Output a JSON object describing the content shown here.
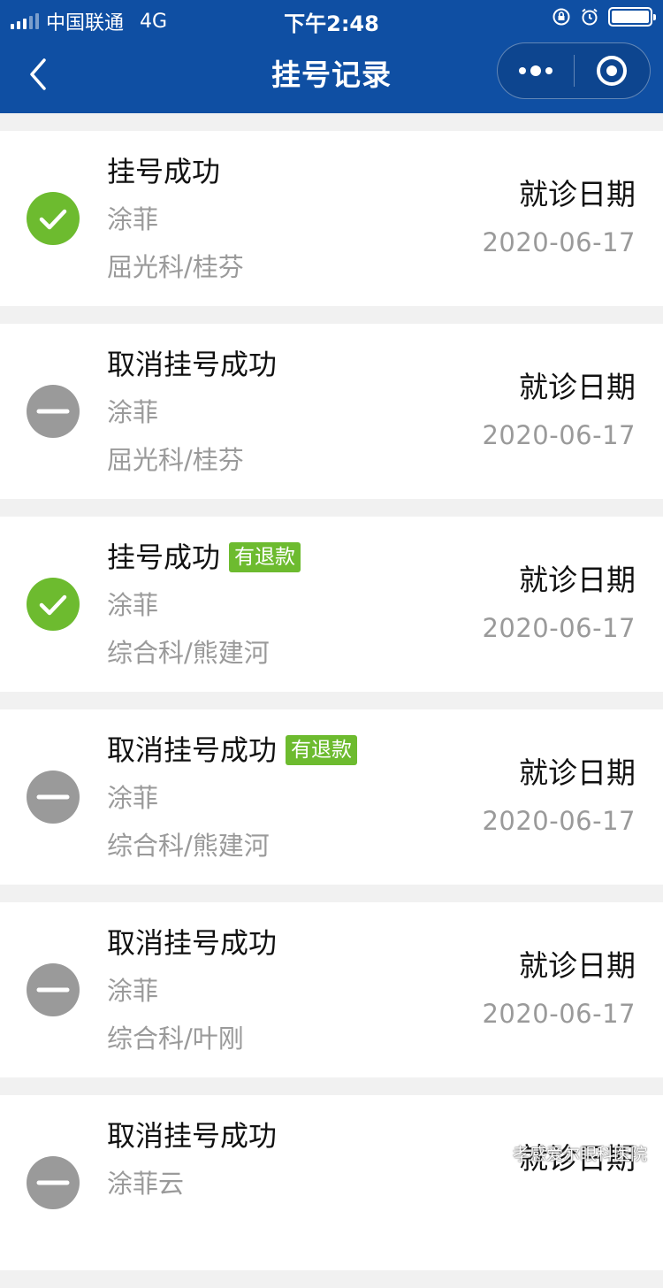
{
  "status_bar": {
    "carrier": "中国联通",
    "network": "4G",
    "time": "下午2:48"
  },
  "nav": {
    "title": "挂号记录",
    "back_icon": "chevron-left-icon",
    "more_icon": "more-dots-icon",
    "close_icon": "target-icon"
  },
  "colors": {
    "header_bg": "#0f4fa3",
    "success": "#6dbb2f",
    "cancelled": "#9a9a9a"
  },
  "records": [
    {
      "status": "挂号成功",
      "state": "success",
      "refund": "",
      "patient": "涂菲",
      "dept": "屈光科/桂芬",
      "date_label": "就诊日期",
      "date": "2020-06-17"
    },
    {
      "status": "取消挂号成功",
      "state": "cancelled",
      "refund": "",
      "patient": "涂菲",
      "dept": "屈光科/桂芬",
      "date_label": "就诊日期",
      "date": "2020-06-17"
    },
    {
      "status": "挂号成功",
      "state": "success",
      "refund": "有退款",
      "patient": "涂菲",
      "dept": "综合科/熊建河",
      "date_label": "就诊日期",
      "date": "2020-06-17"
    },
    {
      "status": "取消挂号成功",
      "state": "cancelled",
      "refund": "有退款",
      "patient": "涂菲",
      "dept": "综合科/熊建河",
      "date_label": "就诊日期",
      "date": "2020-06-17"
    },
    {
      "status": "取消挂号成功",
      "state": "cancelled",
      "refund": "",
      "patient": "涂菲",
      "dept": "综合科/叶刚",
      "date_label": "就诊日期",
      "date": "2020-06-17"
    },
    {
      "status": "取消挂号成功",
      "state": "cancelled",
      "refund": "",
      "patient": "涂菲云",
      "dept": "",
      "date_label": "就诊日期",
      "date": ""
    }
  ],
  "watermark": "孝感爱尔眼科医院"
}
